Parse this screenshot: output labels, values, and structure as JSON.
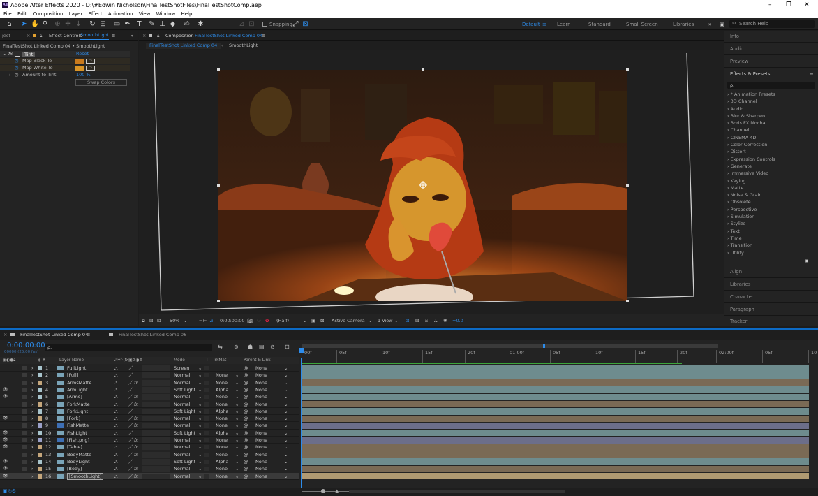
{
  "window": {
    "title": "Adobe After Effects 2020 - D:\\#Edwin Nicholson\\FinalTestShotFiles\\FinalTestShotComp.aep",
    "app_badge": "Ae",
    "controls": [
      "–",
      "❐",
      "✕"
    ]
  },
  "menu": [
    "File",
    "Edit",
    "Composition",
    "Layer",
    "Effect",
    "Animation",
    "View",
    "Window",
    "Help"
  ],
  "toolbar": {
    "snapping": "Snapping",
    "workspaces": [
      "Default",
      "Learn",
      "Standard",
      "Small Screen",
      "Libraries"
    ],
    "search_placeholder": "Search Help"
  },
  "effect_controls": {
    "tab_project": "ject",
    "tab_label": "Effect Controls",
    "tab_layer": "SmoothLight",
    "subtitle": "FinalTestShot Linked Comp 04 • SmoothLight",
    "fx_label": "fx",
    "effect": "Tint",
    "reset": "Reset",
    "props": [
      {
        "label": "Map Black To",
        "color": "#c97a1d"
      },
      {
        "label": "Map White To",
        "color": "#d99427"
      }
    ],
    "amount_label": "Amount to Tint",
    "amount_value": "100 %",
    "swap": "Swap Colors"
  },
  "composition": {
    "tab_label": "Composition",
    "comp_name": "FinalTestShot Linked Comp 04",
    "breadcrumb_active": "FinalTestShot Linked Comp 04",
    "breadcrumb_next": "SmoothLight"
  },
  "viewer_bar": {
    "zoom": "50%",
    "timecode": "0:00:00:00",
    "resolution": "(Half)",
    "camera": "Active Camera",
    "views": "1 View",
    "exposure": "+0.0"
  },
  "right_panels": {
    "top": [
      "Info",
      "Audio",
      "Preview"
    ],
    "effects_title": "Effects & Presets",
    "effects_search": "ρ.",
    "effects": [
      "* Animation Presets",
      "3D Channel",
      "Audio",
      "Blur & Sharpen",
      "Boris FX Mocha",
      "Channel",
      "CINEMA 4D",
      "Color Correction",
      "Distort",
      "Expression Controls",
      "Generate",
      "Immersive Video",
      "Keying",
      "Matte",
      "Noise & Grain",
      "Obsolete",
      "Perspective",
      "Simulation",
      "Stylize",
      "Text",
      "Time",
      "Transition",
      "Utility"
    ],
    "bottom": [
      "Align",
      "Libraries",
      "Character",
      "Paragraph",
      "Tracker"
    ]
  },
  "timeline": {
    "tab_active": "FinalTestShot Linked Comp 04",
    "tab_other": "FinalTestShot Linked Comp 06",
    "timecode": "0:00:00:00",
    "fps": "00000 (25.00 fps)",
    "search": "ρ.",
    "headers": {
      "layer_name": "Layer Name",
      "mode": "Mode",
      "t": "T",
      "trkmat": "TrkMat",
      "parent": "Parent & Link"
    },
    "ruler": [
      "00f",
      "05f",
      "10f",
      "15f",
      "20f",
      "01:00f",
      "05f",
      "10f",
      "15f",
      "20f",
      "02:00f",
      "05f",
      "10"
    ],
    "layers": [
      {
        "num": "1",
        "name": "FullLight",
        "label": "#a8c4cc",
        "type": "comp",
        "mode": "Screen",
        "trk": "",
        "parent": "None",
        "fx": false,
        "eye": false,
        "bar": "#6e8c8e"
      },
      {
        "num": "2",
        "name": "[Full]",
        "label": "#a8c4cc",
        "type": "comp",
        "mode": "Normal",
        "trk": "None",
        "parent": "None",
        "fx": false,
        "eye": false,
        "bar": "#6e8c8e"
      },
      {
        "num": "3",
        "name": "ArmsMatte",
        "label": "#c4a67c",
        "type": "solid",
        "mode": "Normal",
        "trk": "None",
        "parent": "None",
        "fx": true,
        "eye": false,
        "bar": "#7a6a55"
      },
      {
        "num": "4",
        "name": "ArmLight",
        "label": "#a8c4cc",
        "type": "comp",
        "mode": "Soft Light",
        "trk": "Alpha",
        "parent": "None",
        "fx": false,
        "eye": true,
        "bar": "#6e8c8e"
      },
      {
        "num": "5",
        "name": "[Arms]",
        "label": "#a8c4cc",
        "type": "comp",
        "mode": "Normal",
        "trk": "None",
        "parent": "None",
        "fx": true,
        "eye": true,
        "bar": "#6e8c8e"
      },
      {
        "num": "6",
        "name": "ForkMatte",
        "label": "#c4a67c",
        "type": "solid",
        "mode": "Normal",
        "trk": "None",
        "parent": "None",
        "fx": true,
        "eye": false,
        "bar": "#7a6a55"
      },
      {
        "num": "7",
        "name": "ForkLight",
        "label": "#a8c4cc",
        "type": "comp",
        "mode": "Soft Light",
        "trk": "Alpha",
        "parent": "None",
        "fx": false,
        "eye": false,
        "bar": "#6e8c8e"
      },
      {
        "num": "8",
        "name": "[Fork]",
        "label": "#c4a67c",
        "type": "solid",
        "mode": "Normal",
        "trk": "None",
        "parent": "None",
        "fx": true,
        "eye": true,
        "bar": "#7a6a55"
      },
      {
        "num": "9",
        "name": "FishMatte",
        "label": "#9aa0c8",
        "type": "file",
        "mode": "Normal",
        "trk": "None",
        "parent": "None",
        "fx": true,
        "eye": false,
        "bar": "#6c6e8a"
      },
      {
        "num": "10",
        "name": "FishLight",
        "label": "#a8c4cc",
        "type": "comp",
        "mode": "Soft Light",
        "trk": "Alpha",
        "parent": "None",
        "fx": false,
        "eye": true,
        "bar": "#6e8c8e"
      },
      {
        "num": "11",
        "name": "[Fish.png]",
        "label": "#9aa0c8",
        "type": "file",
        "mode": "Normal",
        "trk": "None",
        "parent": "None",
        "fx": true,
        "eye": true,
        "bar": "#6c6e8a"
      },
      {
        "num": "12",
        "name": "[Table]",
        "label": "#c4a67c",
        "type": "solid",
        "mode": "Normal",
        "trk": "None",
        "parent": "None",
        "fx": true,
        "eye": true,
        "bar": "#7a6a55"
      },
      {
        "num": "13",
        "name": "BodyMatte",
        "label": "#c4a67c",
        "type": "solid",
        "mode": "Normal",
        "trk": "None",
        "parent": "None",
        "fx": true,
        "eye": false,
        "bar": "#7a6a55"
      },
      {
        "num": "14",
        "name": "BodyLight",
        "label": "#a8c4cc",
        "type": "comp",
        "mode": "Soft Light",
        "trk": "Alpha",
        "parent": "None",
        "fx": false,
        "eye": true,
        "bar": "#6e8c8e"
      },
      {
        "num": "15",
        "name": "[Body]",
        "label": "#c4a67c",
        "type": "solid",
        "mode": "Normal",
        "trk": "None",
        "parent": "None",
        "fx": true,
        "eye": true,
        "bar": "#7a6a55"
      },
      {
        "num": "16",
        "name": "[SmoothLight]",
        "label": "#c4a67c",
        "type": "solid",
        "mode": "Normal",
        "trk": "None",
        "parent": "None",
        "fx": true,
        "eye": true,
        "bar": "#b09a72",
        "selected": true
      }
    ]
  }
}
